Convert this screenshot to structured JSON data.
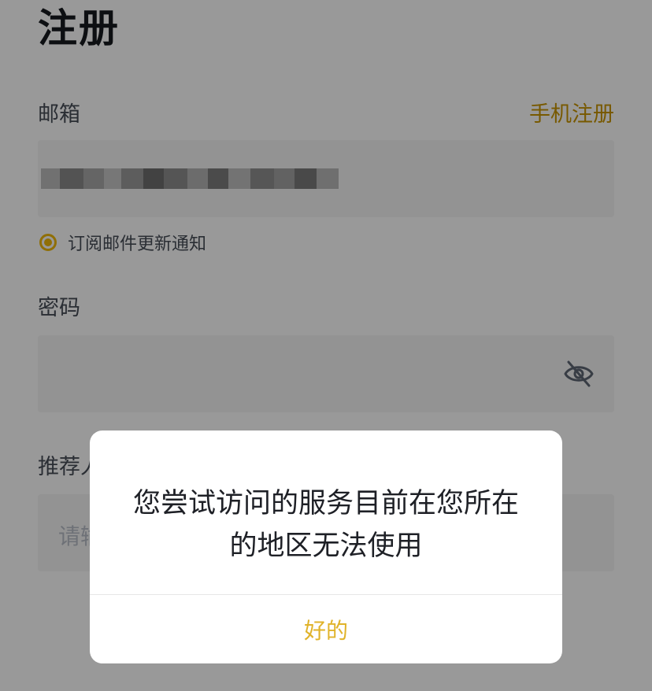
{
  "page": {
    "title": "注册",
    "email": {
      "label": "邮箱",
      "switch_link": "手机注册",
      "value": ""
    },
    "subscribe": {
      "label": "订阅邮件更新通知",
      "checked": true
    },
    "password": {
      "label": "密码",
      "visibility_icon": "eye-slash-icon"
    },
    "referral": {
      "label": "推荐人",
      "placeholder": "请输"
    }
  },
  "dialog": {
    "message": "您尝试访问的服务目前在您所在的地区无法使用",
    "confirm_label": "好的"
  },
  "colors": {
    "accent": "#F0B90B",
    "link": "#C99400",
    "dialog_button": "#E0B32A",
    "text_primary": "#1E2026",
    "input_bg": "#F5F5F5"
  }
}
